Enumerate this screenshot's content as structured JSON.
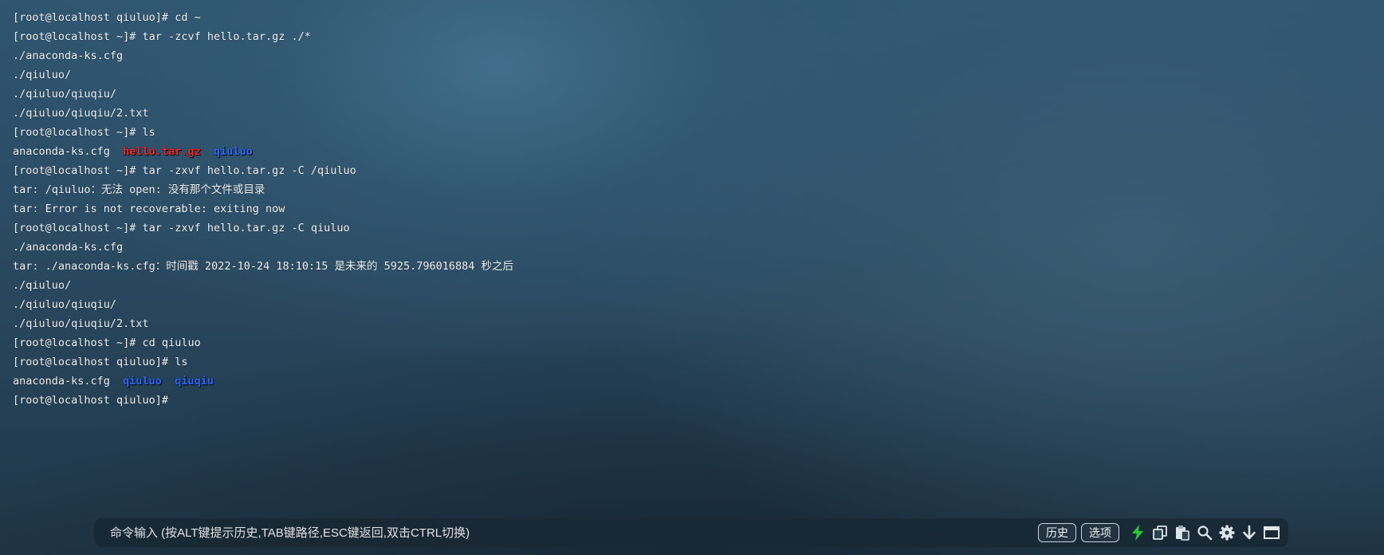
{
  "terminal": {
    "lines": [
      [
        {
          "t": "[root@localhost qiuluo]# cd ~",
          "c": "default"
        }
      ],
      [
        {
          "t": "[root@localhost ~]# tar -zcvf hello.tar.gz ./*",
          "c": "default"
        }
      ],
      [
        {
          "t": "./anaconda-ks.cfg",
          "c": "default"
        }
      ],
      [
        {
          "t": "./qiuluo/",
          "c": "default"
        }
      ],
      [
        {
          "t": "./qiuluo/qiuqiu/",
          "c": "default"
        }
      ],
      [
        {
          "t": "./qiuluo/qiuqiu/2.txt",
          "c": "default"
        }
      ],
      [
        {
          "t": "[root@localhost ~]# ls",
          "c": "default"
        }
      ],
      [
        {
          "t": "anaconda-ks.cfg  ",
          "c": "default"
        },
        {
          "t": "hello.tar.gz",
          "c": "red"
        },
        {
          "t": "  ",
          "c": "default"
        },
        {
          "t": "qiuluo",
          "c": "blue"
        }
      ],
      [
        {
          "t": "[root@localhost ~]# tar -zxvf hello.tar.gz -C /qiuluo",
          "c": "default"
        }
      ],
      [
        {
          "t": "tar: /qiuluo：无法 open: 没有那个文件或目录",
          "c": "default"
        }
      ],
      [
        {
          "t": "tar: Error is not recoverable: exiting now",
          "c": "default"
        }
      ],
      [
        {
          "t": "[root@localhost ~]# tar -zxvf hello.tar.gz -C qiuluo",
          "c": "default"
        }
      ],
      [
        {
          "t": "./anaconda-ks.cfg",
          "c": "default"
        }
      ],
      [
        {
          "t": "tar: ./anaconda-ks.cfg：时间戳 2022-10-24 18:10:15 是未来的 5925.796016884 秒之后",
          "c": "default"
        }
      ],
      [
        {
          "t": "./qiuluo/",
          "c": "default"
        }
      ],
      [
        {
          "t": "./qiuluo/qiuqiu/",
          "c": "default"
        }
      ],
      [
        {
          "t": "./qiuluo/qiuqiu/2.txt",
          "c": "default"
        }
      ],
      [
        {
          "t": "[root@localhost ~]# cd qiuluo",
          "c": "default"
        }
      ],
      [
        {
          "t": "[root@localhost qiuluo]# ls",
          "c": "default"
        }
      ],
      [
        {
          "t": "anaconda-ks.cfg  ",
          "c": "default"
        },
        {
          "t": "qiuluo",
          "c": "blue"
        },
        {
          "t": "  ",
          "c": "default"
        },
        {
          "t": "qiuqiu",
          "c": "blue"
        }
      ],
      [
        {
          "t": "[root@localhost qiuluo]#",
          "c": "default"
        }
      ]
    ]
  },
  "command_bar": {
    "placeholder": "命令输入 (按ALT键提示历史,TAB键路径,ESC键返回,双击CTRL切换)",
    "history_label": "历史",
    "options_label": "选项",
    "icons": [
      "lightning-icon",
      "copy-icon",
      "paste-icon",
      "search-icon",
      "gear-icon",
      "download-arrow-icon",
      "window-icon"
    ]
  },
  "colors": {
    "text": "#f2f2f2",
    "archive_red": "#ff2020",
    "directory_blue": "#2a6bff",
    "lightning_green": "#22cc33"
  }
}
